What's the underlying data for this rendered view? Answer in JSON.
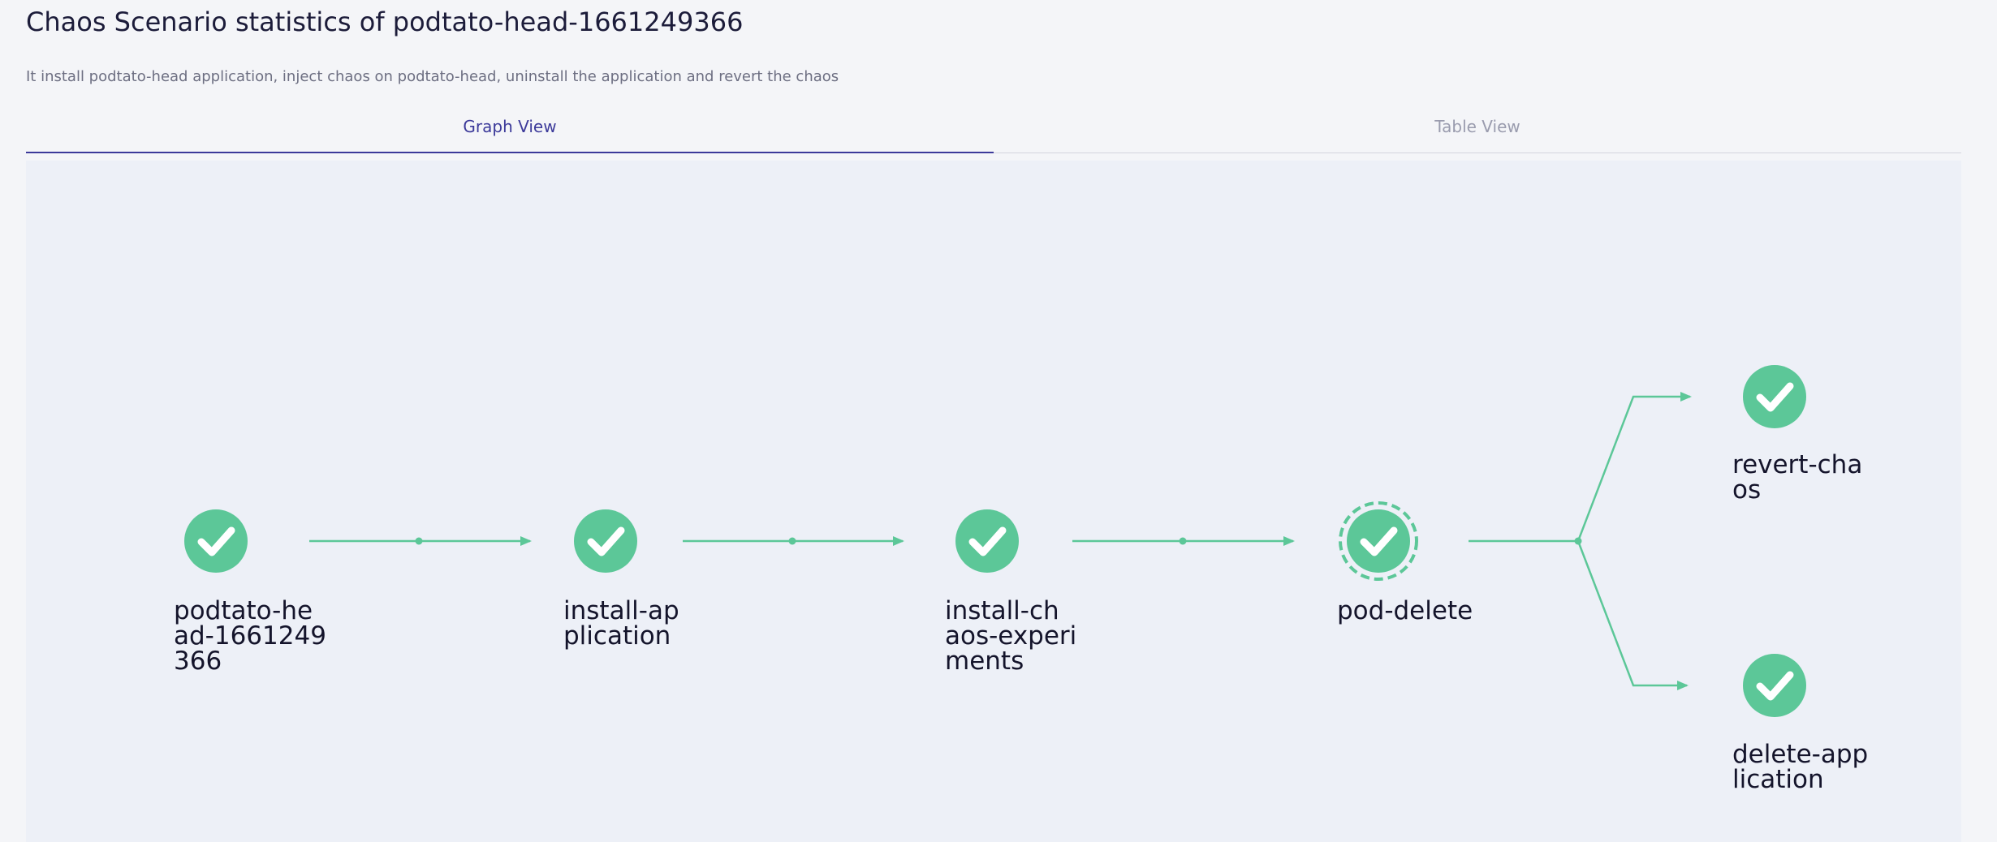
{
  "header": {
    "title": "Chaos Scenario statistics of podtato-head-1661249366",
    "description": "It install podtato-head application, inject chaos on podtato-head, uninstall the application and revert the chaos"
  },
  "tabs": [
    {
      "label": "Graph View",
      "active": true
    },
    {
      "label": "Table View",
      "active": false
    }
  ],
  "graph": {
    "colors": {
      "success": "#5cc798",
      "check": "#ffffff",
      "background": "#edf0f7"
    },
    "nodes": [
      {
        "name": "podtato-head-1661249366",
        "label_lines": [
          "podtato-he",
          "ad-1661249",
          "366"
        ],
        "status": "succeeded",
        "icon": "check-icon"
      },
      {
        "name": "install-application",
        "label_lines": [
          "install-ap",
          "plication"
        ],
        "status": "succeeded",
        "icon": "check-icon"
      },
      {
        "name": "install-chaos-experiments",
        "label_lines": [
          "install-ch",
          "aos-experi",
          "ments"
        ],
        "status": "succeeded",
        "icon": "check-icon"
      },
      {
        "name": "pod-delete",
        "label_lines": [
          "pod-delete"
        ],
        "status": "succeeded",
        "icon": "check-icon",
        "selected": true
      },
      {
        "name": "revert-chaos",
        "label_lines": [
          "revert-cha",
          "os"
        ],
        "status": "succeeded",
        "icon": "check-icon"
      },
      {
        "name": "delete-application",
        "label_lines": [
          "delete-app",
          "lication"
        ],
        "status": "succeeded",
        "icon": "check-icon"
      }
    ],
    "edges": [
      {
        "from": "podtato-head-1661249366",
        "to": "install-application"
      },
      {
        "from": "install-application",
        "to": "install-chaos-experiments"
      },
      {
        "from": "install-chaos-experiments",
        "to": "pod-delete"
      },
      {
        "from": "pod-delete",
        "to": "revert-chaos"
      },
      {
        "from": "pod-delete",
        "to": "delete-application"
      }
    ]
  }
}
